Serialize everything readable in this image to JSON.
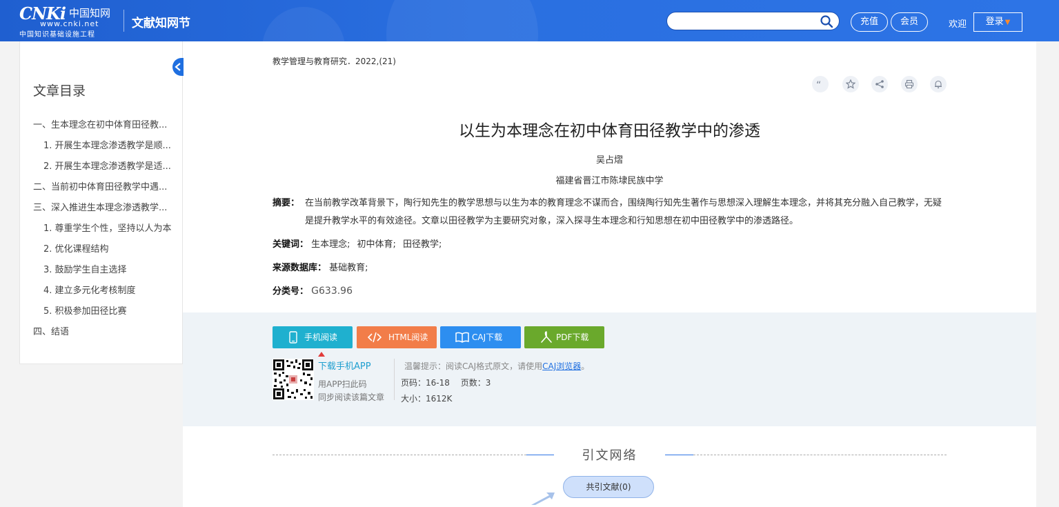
{
  "header": {
    "logo_main": "CNKi",
    "logo_cn": "中国知网",
    "logo_url": "www.cnki.net",
    "logo_sub": "中国知识基础设施工程",
    "site_name": "文献知网节",
    "search": {
      "placeholder": "",
      "icon": "search-icon"
    },
    "recharge_label": "充值",
    "member_label": "会员",
    "welcome": "欢迎",
    "login_label": "登录"
  },
  "sidebar": {
    "title": "文章目录",
    "items": [
      {
        "label": "一、生本理念在初中体育田径教...",
        "level": 1
      },
      {
        "label": "1. 开展生本理念渗透教学是顺...",
        "level": 2
      },
      {
        "label": "2. 开展生本理念渗透教学是适...",
        "level": 2
      },
      {
        "label": "二、当前初中体育田径教学中遇...",
        "level": 1
      },
      {
        "label": "三、深入推进生本理念渗透教学...",
        "level": 1
      },
      {
        "label": "1. 尊重学生个性，坚持以人为本",
        "level": 2
      },
      {
        "label": "2. 优化课程结构",
        "level": 2
      },
      {
        "label": "3. 鼓励学生自主选择",
        "level": 2
      },
      {
        "label": "4. 建立多元化考核制度",
        "level": 2
      },
      {
        "label": "5. 积极参加田径比赛",
        "level": 2
      },
      {
        "label": "四、结语",
        "level": 1
      }
    ]
  },
  "article": {
    "journal": "教学管理与教育研究．2022,(21)",
    "title": "以生为本理念在初中体育田径教学中的渗透",
    "author": "吴占熠",
    "organization": "福建省晋江市陈埭民族中学",
    "abstract_label": "摘要：",
    "abstract": "在当前教学改革背景下，陶行知先生的教学思想与以生为本的教育理念不谋而合，围绕陶行知先生著作与思想深入理解生本理念，并将其充分融入自己教学，无疑是提升教学水平的有效途径。文章以田径教学为主要研究对象，深入探寻生本理念和行知思想在初中田径教学中的渗透路径。",
    "keywords_label": "关键词：",
    "keywords": [
      "生本理念;",
      "初中体育;",
      "田径教学;"
    ],
    "source_label": "来源数据库：",
    "source": "基础教育;",
    "class_label": "分类号：",
    "class_no": "G633.96"
  },
  "tools": [
    "quote-icon",
    "star-icon",
    "share-icon",
    "print-icon",
    "bell-icon"
  ],
  "download": {
    "mobile_label": "手机阅读",
    "html_label": "HTML阅读",
    "caj_label": "CAJ下载",
    "pdf_label": "PDF下载",
    "app_link": "下载手机APP",
    "app_line1": "用APP扫此码",
    "app_line2": "同步阅读该篇文章",
    "tip_prefix": "温馨提示：阅读CAJ格式原文，请使用",
    "tip_link": "CAJ浏览器",
    "tip_suffix": "。",
    "pages_label": "页码：",
    "pages": "16-18",
    "page_count_label": "页数：",
    "page_count": "3",
    "size_label": "大小：",
    "size": "1612K"
  },
  "citation": {
    "title": "引文网络",
    "co_cite_label": "共引文献(0)"
  },
  "colors": {
    "header": "#2a6fe0",
    "mobile": "#1fb0cf",
    "html": "#f27d49",
    "caj": "#2d8ef0",
    "pdf": "#6aa92c"
  }
}
